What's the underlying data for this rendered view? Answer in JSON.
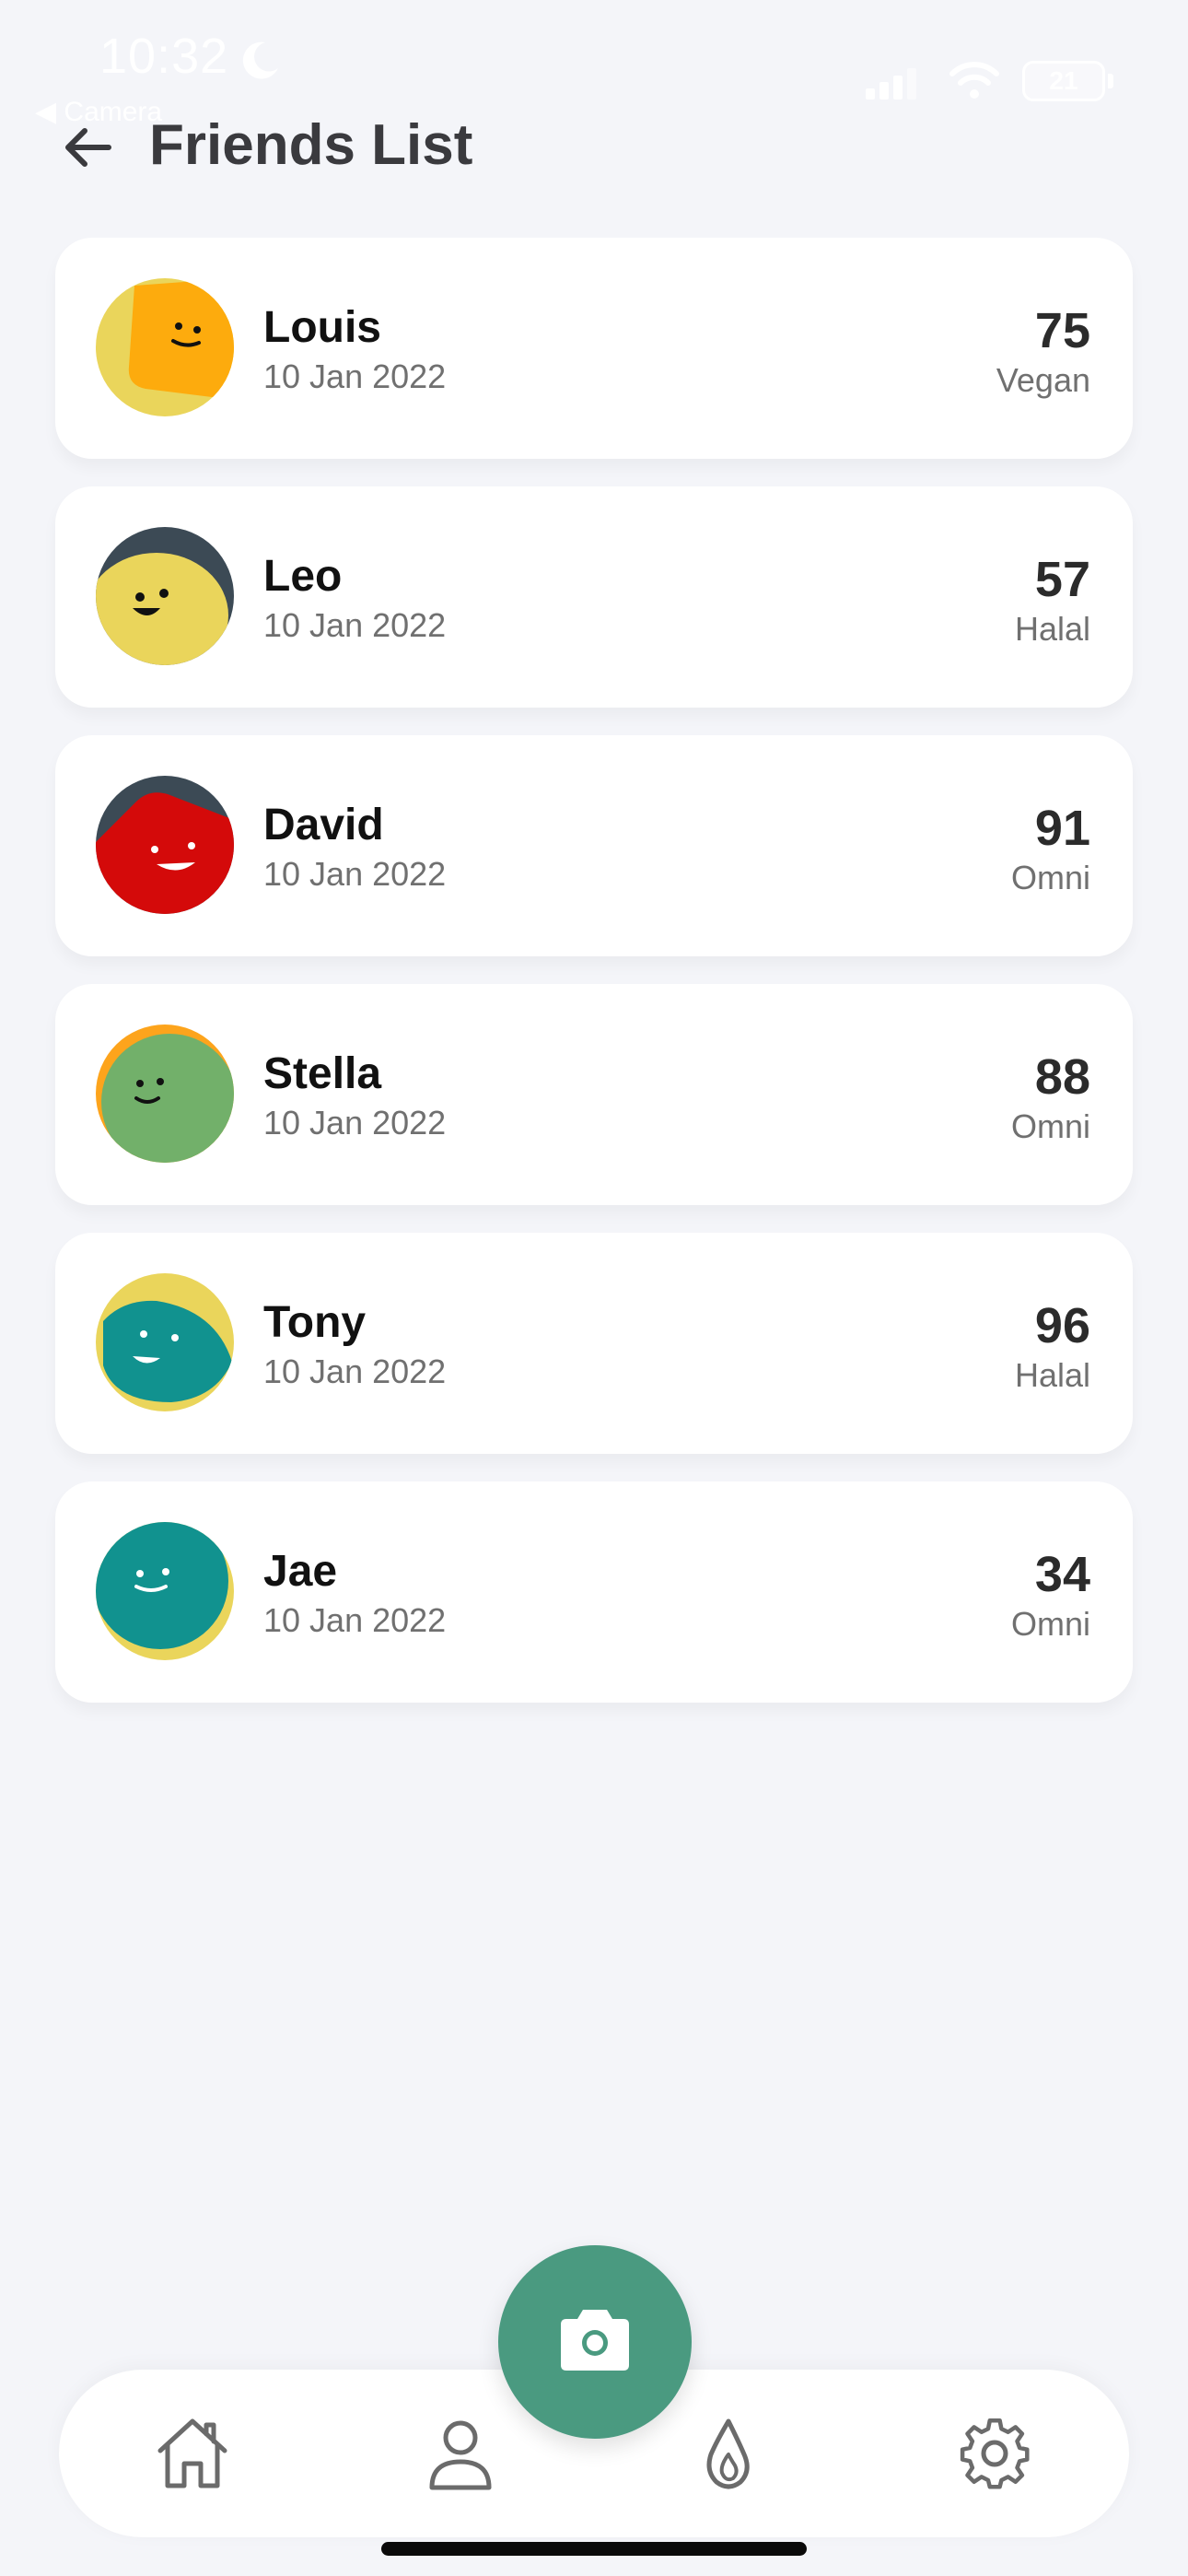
{
  "status_bar": {
    "time": "10:32",
    "back_app": "◀ Camera",
    "battery": "21"
  },
  "header": {
    "title": "Friends List",
    "back_icon": "arrow-left-icon"
  },
  "friends": [
    {
      "name": "Louis",
      "date": "10 Jan 2022",
      "score": "75",
      "diet": "Vegan"
    },
    {
      "name": "Leo",
      "date": "10 Jan 2022",
      "score": "57",
      "diet": "Halal"
    },
    {
      "name": "David",
      "date": "10 Jan 2022",
      "score": "91",
      "diet": "Omni"
    },
    {
      "name": "Stella",
      "date": "10 Jan 2022",
      "score": "88",
      "diet": "Omni"
    },
    {
      "name": "Tony",
      "date": "10 Jan 2022",
      "score": "96",
      "diet": "Halal"
    },
    {
      "name": "Jae",
      "date": "10 Jan 2022",
      "score": "34",
      "diet": "Omni"
    }
  ],
  "bottom_nav": {
    "items": [
      "home-icon",
      "profile-icon",
      "camera-icon",
      "flame-icon",
      "settings-icon"
    ]
  },
  "colors": {
    "background": "#f4f5f9",
    "accent": "#4a9a80",
    "card": "#ffffff"
  }
}
